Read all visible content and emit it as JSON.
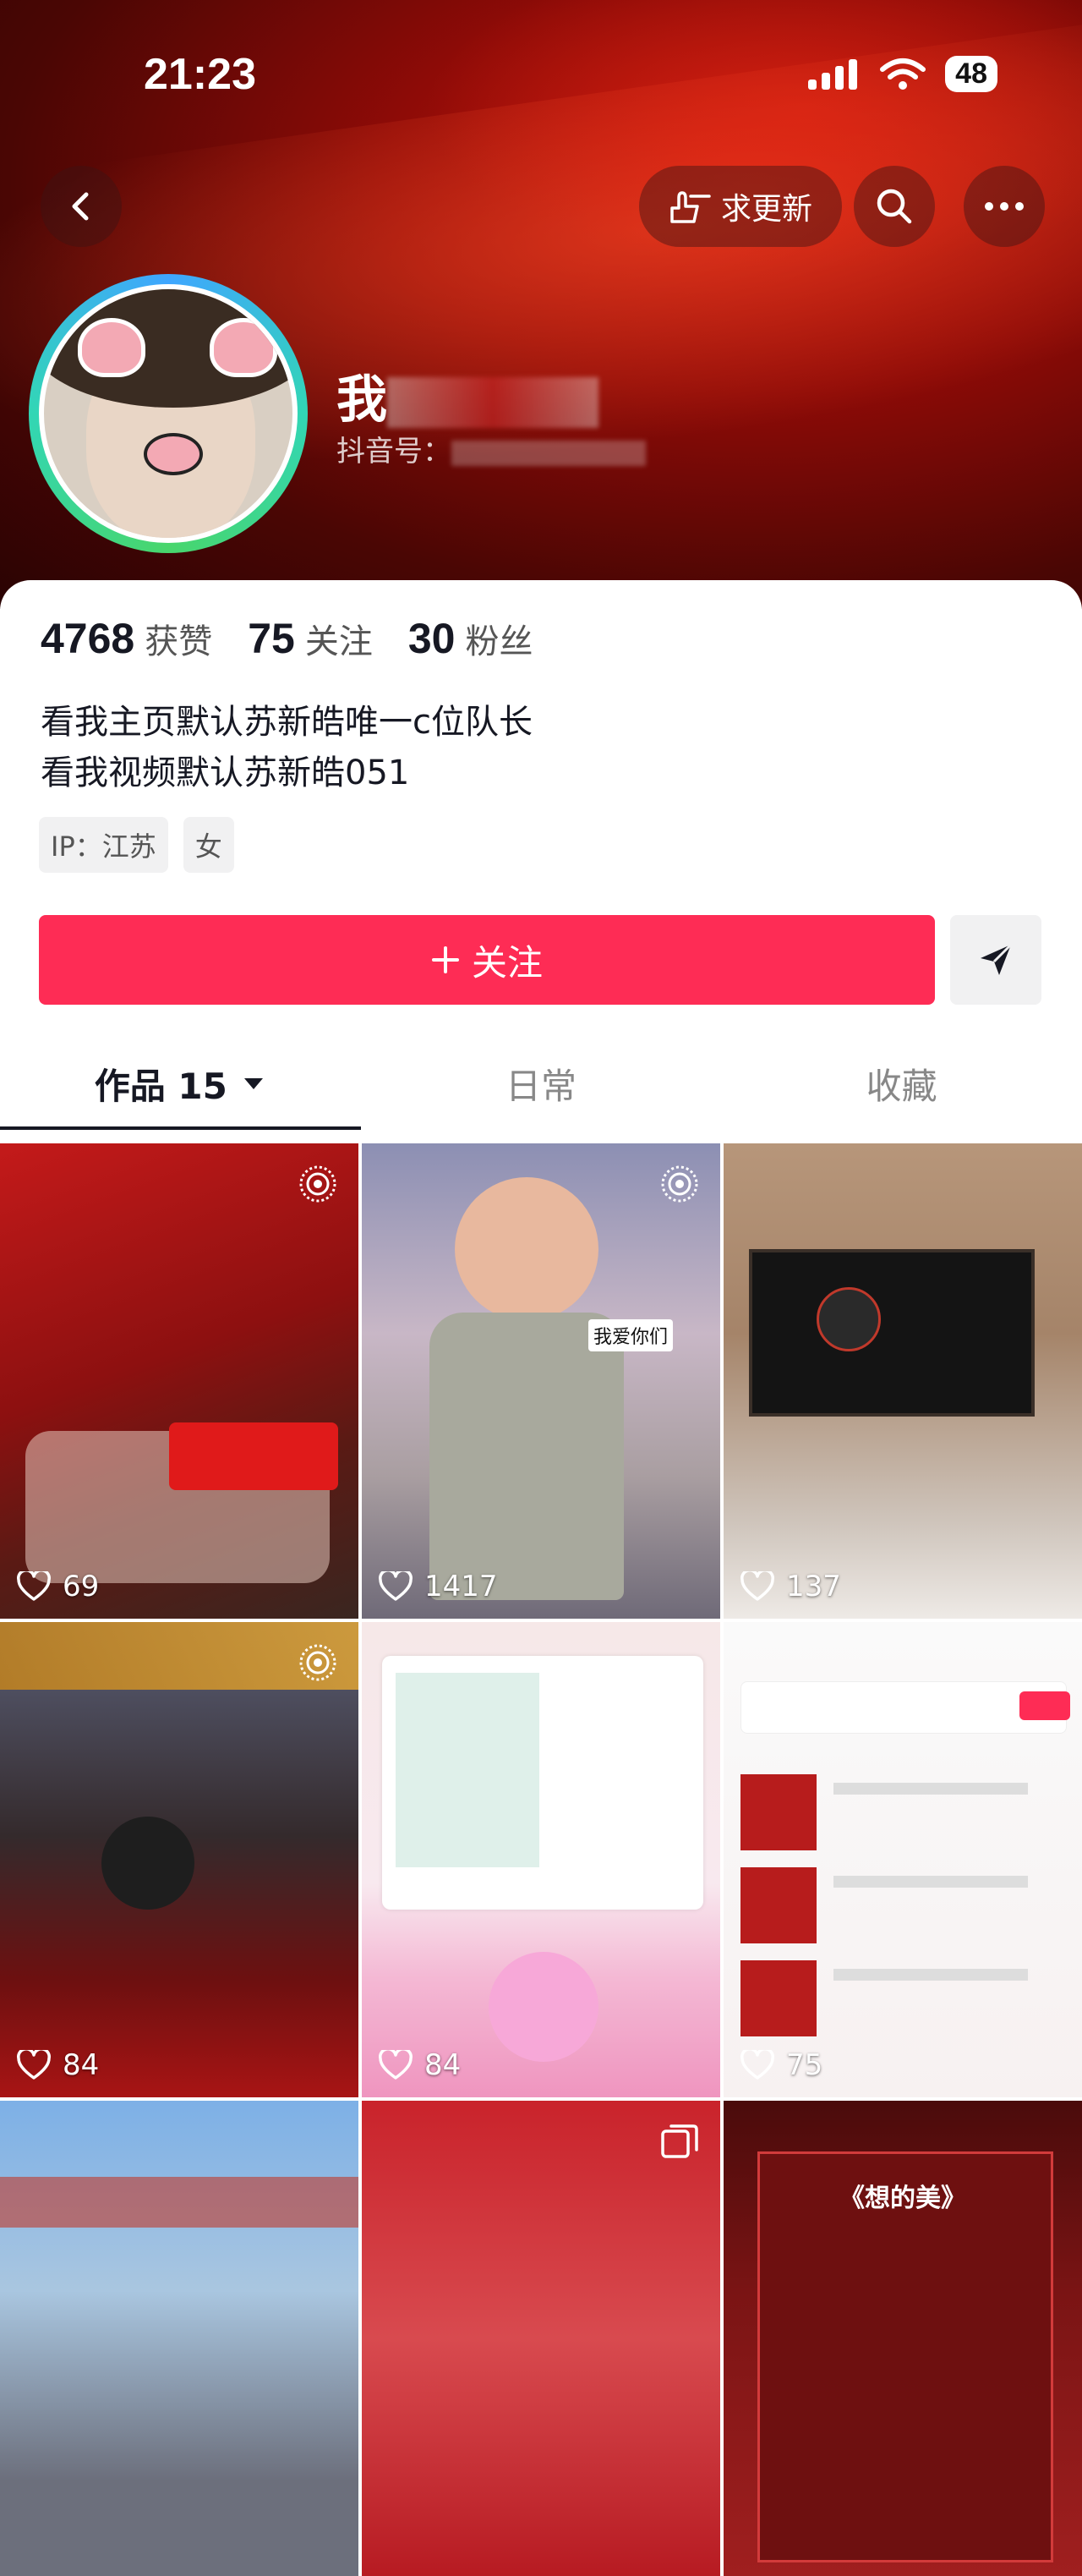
{
  "status_bar": {
    "time": "21:23",
    "battery": "48"
  },
  "header": {
    "request_update_label": "求更新",
    "name_visible": "我",
    "douyin_id_label": "抖音号："
  },
  "stats": [
    {
      "value": "4768",
      "label": "获赞"
    },
    {
      "value": "75",
      "label": "关注"
    },
    {
      "value": "30",
      "label": "粉丝"
    }
  ],
  "bio": {
    "line1": "看我主页默认苏新皓唯一c位队长",
    "line2": "看我视频默认苏新皓051"
  },
  "tags": [
    "IP：江苏",
    "女"
  ],
  "actions": {
    "follow_label": "关注"
  },
  "tabs": [
    {
      "label": "作品 15"
    },
    {
      "label": "日常"
    },
    {
      "label": "收藏"
    }
  ],
  "videos": [
    {
      "likes": "69",
      "pinned_icon": "live-photo-icon"
    },
    {
      "likes": "1417",
      "pinned_icon": "live-photo-icon",
      "overlay_text": "我爱你们"
    },
    {
      "likes": "137"
    },
    {
      "likes": "84",
      "pinned_icon": "live-photo-icon"
    },
    {
      "likes": "84"
    },
    {
      "likes": "75"
    },
    {
      "likes": ""
    },
    {
      "likes": "",
      "pinned_icon": "multi-image-icon"
    },
    {
      "likes": "",
      "overlay_text": "《想的美》"
    }
  ],
  "colors": {
    "accent": "#fe2c55",
    "text": "#161823",
    "secondary": "#888888"
  }
}
